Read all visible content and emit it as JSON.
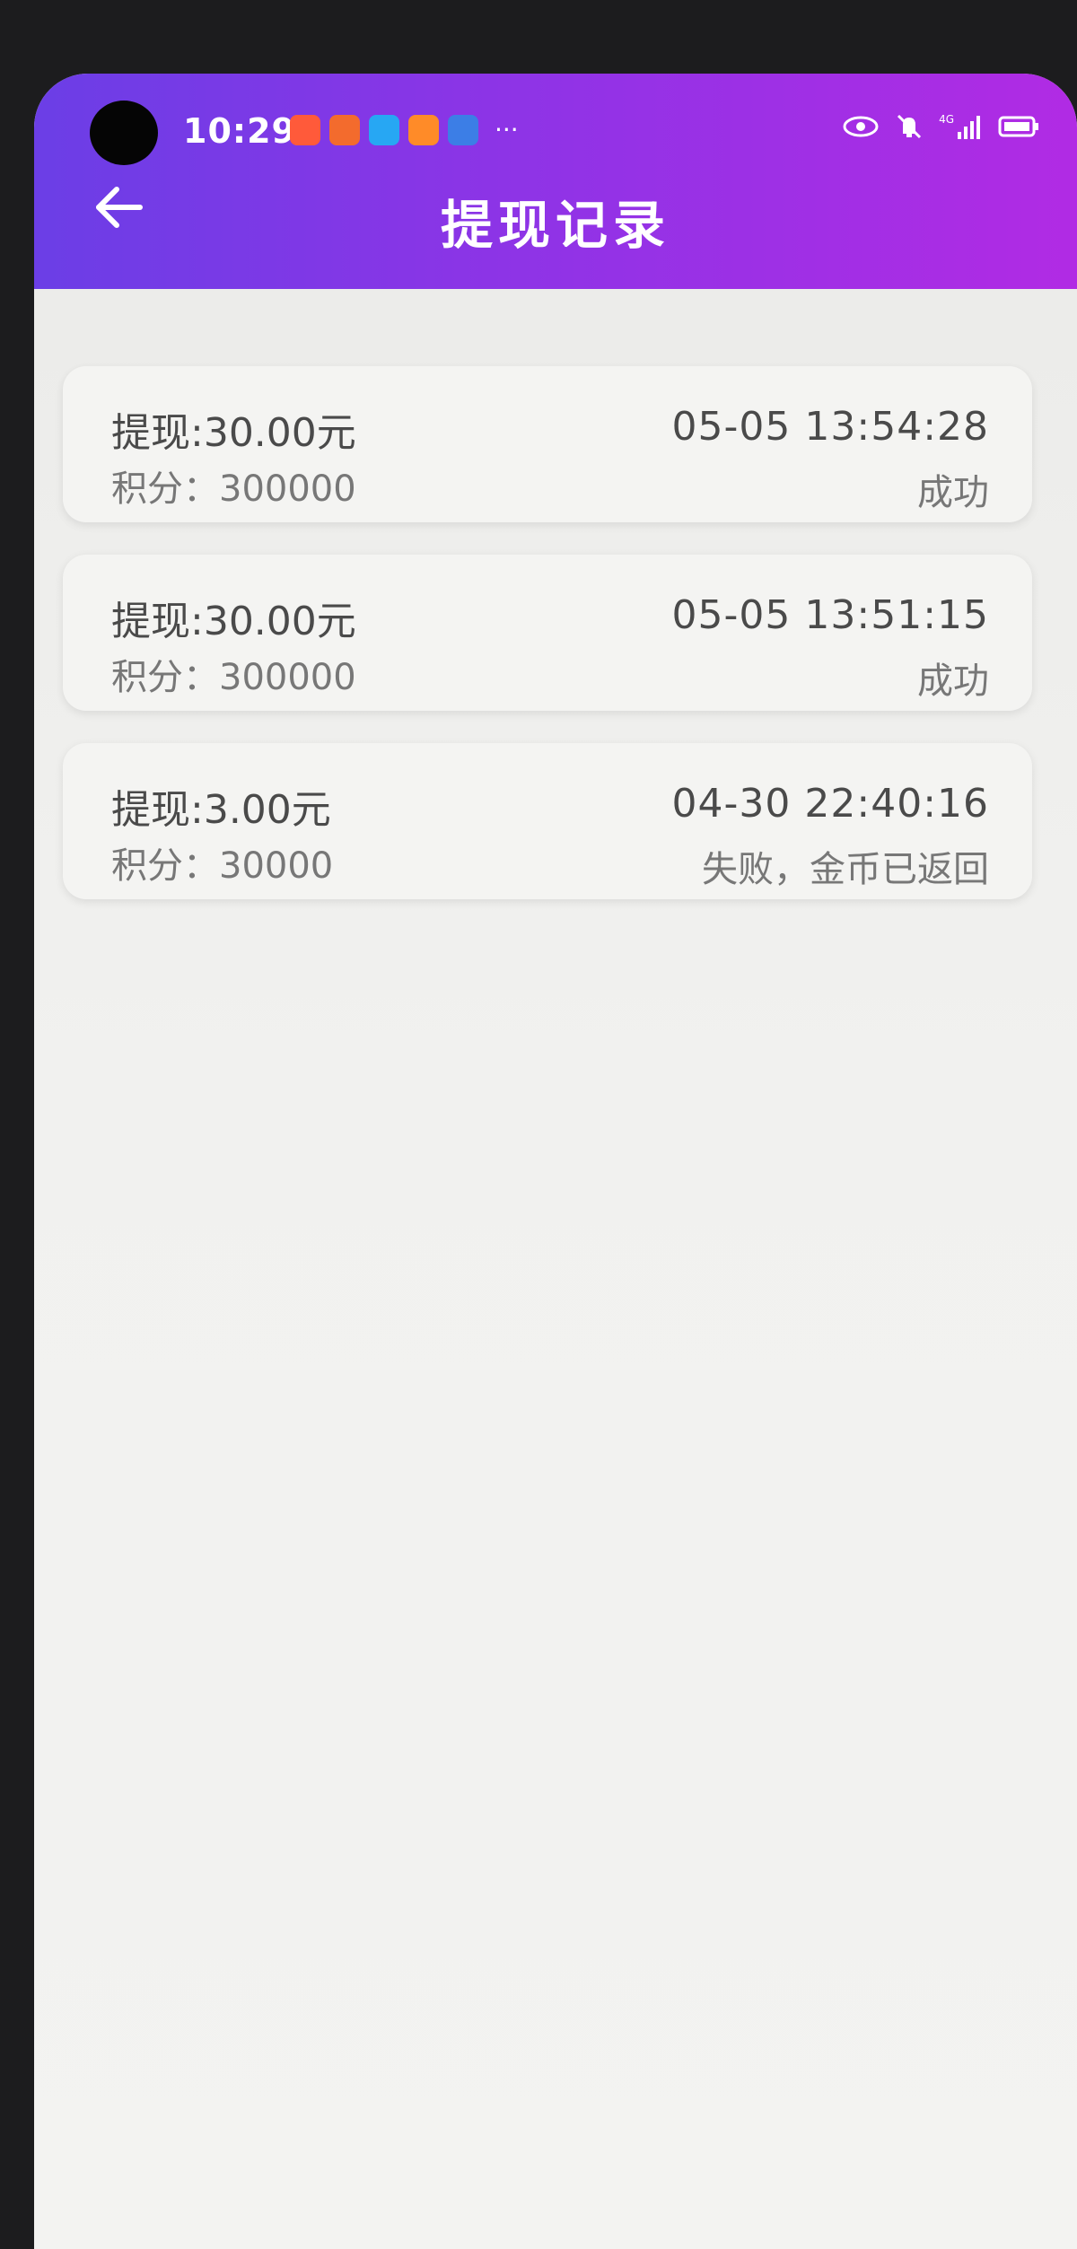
{
  "status_bar": {
    "time": "10:29",
    "more_indicator": "···",
    "network_label": "4G"
  },
  "header": {
    "title": "提现记录"
  },
  "records": [
    {
      "amount": "提现:30.00元",
      "points": "积分：300000",
      "datetime": "05-05 13:54:28",
      "status": "成功"
    },
    {
      "amount": "提现:30.00元",
      "points": "积分：300000",
      "datetime": "05-05 13:51:15",
      "status": "成功"
    },
    {
      "amount": "提现:3.00元",
      "points": "积分：30000",
      "datetime": "04-30 22:40:16",
      "status": "失败，金币已返回"
    }
  ],
  "colors": {
    "header_gradient_start": "#6b3ee6",
    "header_gradient_end": "#b12be4",
    "card_background": "#f4f4f2",
    "page_background": "#efefed"
  }
}
